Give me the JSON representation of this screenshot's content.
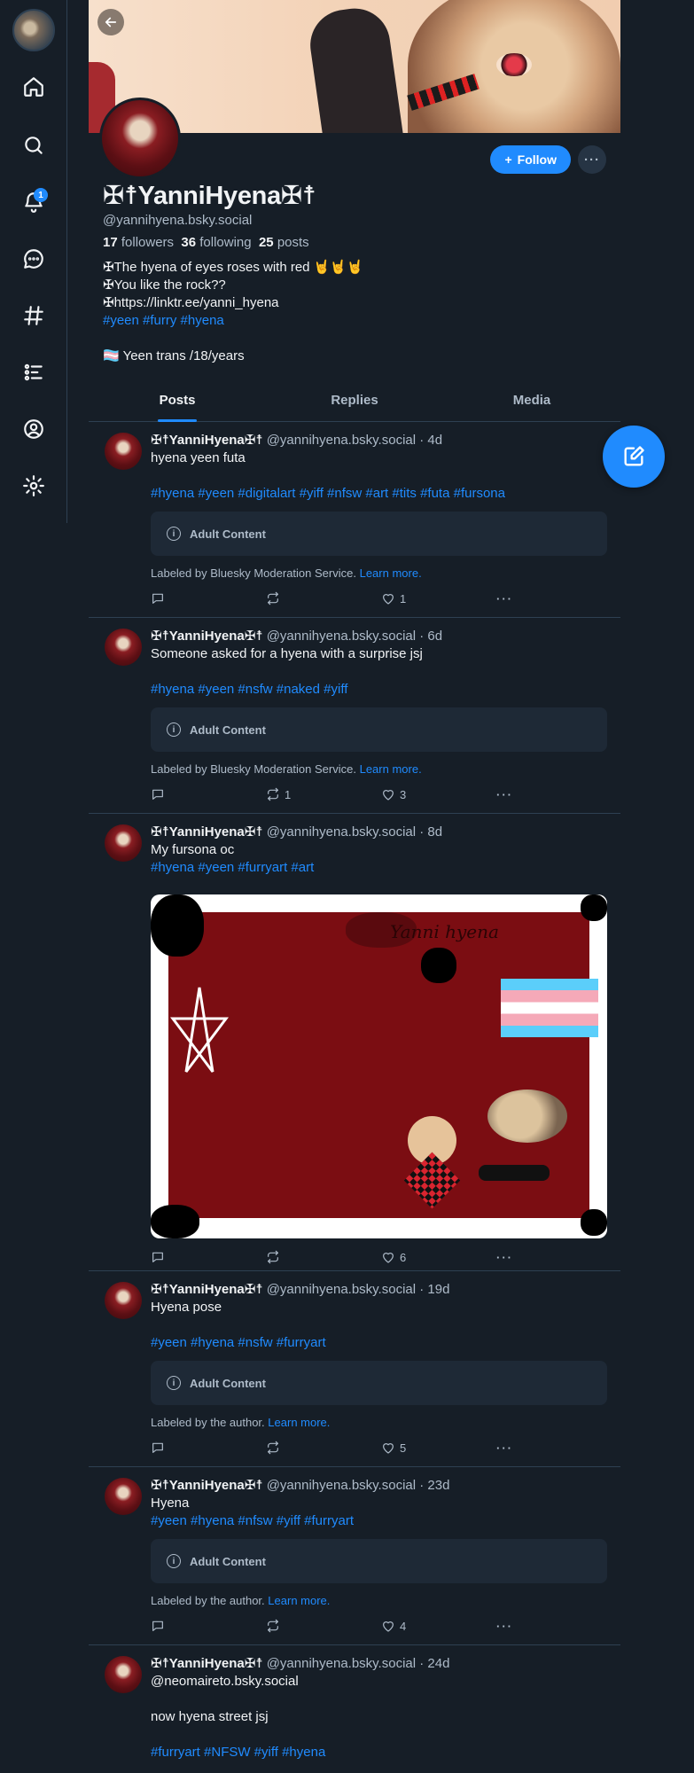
{
  "rail": {
    "notification_count": "1"
  },
  "profile": {
    "display_name": "✠☨YanniHyena✠☨",
    "handle": "@yannihyena.bsky.social",
    "followers_count": "17",
    "followers_label": "followers",
    "following_count": "36",
    "following_label": "following",
    "posts_count": "25",
    "posts_label": "posts",
    "follow_label": "Follow",
    "bio_lines": [
      "✠The hyena of eyes roses with red 🤘🤘🤘",
      "✠You like the rock??",
      "✠https://linktr.ee/yanni_hyena"
    ],
    "bio_tags": "#yeen #furry #hyena",
    "bio_footer": "🏳️‍⚧️ Yeen trans /18/years"
  },
  "tabs": [
    "Posts",
    "Replies",
    "Media"
  ],
  "posts": [
    {
      "name": "✠☨YanniHyena✠☨",
      "handle": "@yannihyena.bsky.social",
      "age": "· 4d",
      "text": "hyena yeen futa",
      "tags": "#hyena #yeen #digitalart #yiff #nfsw #art #tits #futa #fursona",
      "warning": "Adult Content",
      "label_text": "Labeled by Bluesky Moderation Service.",
      "learn_more": "Learn more.",
      "replies": "",
      "reposts": "",
      "likes": "1"
    },
    {
      "name": "✠☨YanniHyena✠☨",
      "handle": "@yannihyena.bsky.social",
      "age": "· 6d",
      "text": "Someone asked for a hyena with a surprise jsj",
      "tags": "#hyena #yeen #nsfw #naked #yiff",
      "warning": "Adult Content",
      "label_text": "Labeled by Bluesky Moderation Service.",
      "learn_more": "Learn more.",
      "replies": "",
      "reposts": "1",
      "likes": "3"
    },
    {
      "name": "✠☨YanniHyena✠☨",
      "handle": "@yannihyena.bsky.social",
      "age": "· 8d",
      "text": "My fursona oc",
      "tags": "#hyena #yeen #furryart #art",
      "art_title": "Yanni hyena",
      "replies": "",
      "reposts": "",
      "likes": "6"
    },
    {
      "name": "✠☨YanniHyena✠☨",
      "handle": "@yannihyena.bsky.social",
      "age": "· 19d",
      "text": "Hyena pose",
      "tags": "#yeen #hyena #nsfw #furryart",
      "warning": "Adult Content",
      "label_text": "Labeled by the author.",
      "learn_more": "Learn more.",
      "replies": "",
      "reposts": "",
      "likes": "5"
    },
    {
      "name": "✠☨YanniHyena✠☨",
      "handle": "@yannihyena.bsky.social",
      "age": "· 23d",
      "text": "Hyena",
      "tags": "#yeen #hyena #nfsw #yiff #furryart",
      "warning": "Adult Content",
      "label_text": "Labeled by the author.",
      "learn_more": "Learn more.",
      "replies": "",
      "reposts": "",
      "likes": "4"
    },
    {
      "name": "✠☨YanniHyena✠☨",
      "handle": "@yannihyena.bsky.social",
      "age": "· 24d",
      "mention": "@neomaireto.bsky.social",
      "text": "now hyena street jsj",
      "tags": "#furryart #NFSW #yiff #hyena"
    }
  ],
  "colors": {
    "background": "#161e27",
    "accent": "#208bfe",
    "muted_text": "#aebbc9",
    "border": "#2e4052"
  }
}
